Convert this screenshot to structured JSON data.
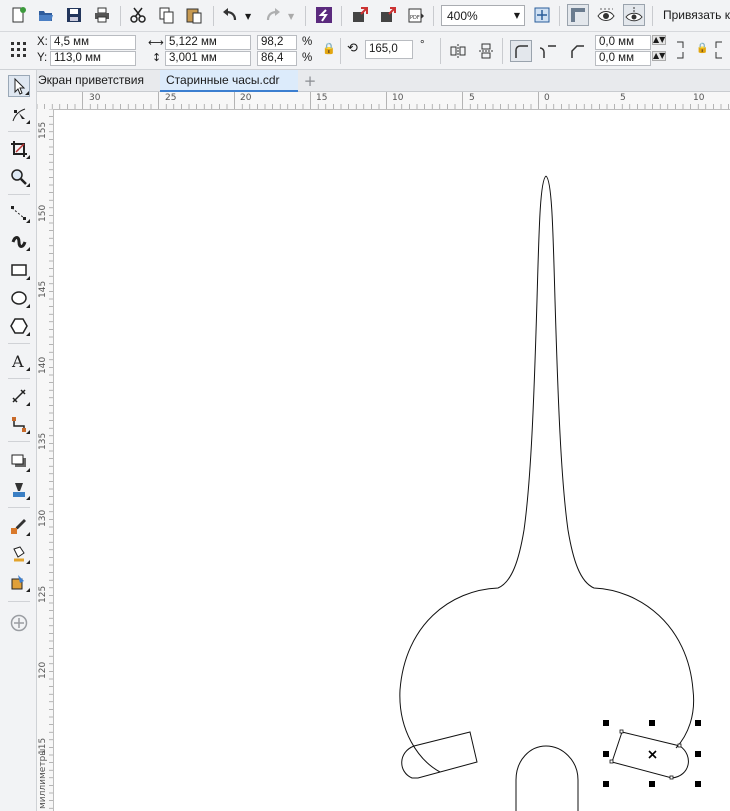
{
  "toolbar": {
    "icons": [
      "new-icon",
      "open-icon",
      "save-icon",
      "print-icon",
      "cut-icon",
      "copy-icon",
      "paste-icon",
      "undo-icon",
      "redo-icon",
      "corel-connect-icon",
      "import-icon",
      "export-icon",
      "export-pdf-icon",
      "zoom-to-page-icon",
      "rulers-toggle-icon",
      "view-icon",
      "snap-guides-icon"
    ],
    "zoom_value": "400%",
    "snap_label": "Привязать к"
  },
  "property_bar": {
    "x_label": "X:",
    "x_value": "4,5 мм",
    "y_label": "Y:",
    "y_value": "113,0 мм",
    "width_value": "5,122 мм",
    "height_value": "3,001 мм",
    "scale_x": "98,2",
    "scale_y": "86,4",
    "percent": "%",
    "rotation_value": "165,0",
    "degree": "°",
    "offset_1": "0,0 мм",
    "offset_2": "0,0 мм"
  },
  "tabs": [
    {
      "label": "Экран приветствия"
    },
    {
      "label": "Старинные часы.cdr"
    }
  ],
  "rulers": {
    "horizontal": [
      "30",
      "25",
      "20",
      "15",
      "10",
      "5",
      "0",
      "5",
      "10"
    ],
    "vertical": [
      "155",
      "150",
      "145",
      "140",
      "135",
      "130",
      "125",
      "120",
      "115"
    ],
    "vertical_unit": "миллиметры"
  },
  "toolbox": [
    "pick-tool-icon",
    "shape-tool-icon",
    "crop-tool-icon",
    "zoom-tool-icon",
    "freehand-tool-icon",
    "artistic-media-icon",
    "rectangle-tool-icon",
    "ellipse-tool-icon",
    "polygon-tool-icon",
    "text-tool-icon",
    "dimension-tool-icon",
    "connector-tool-icon",
    "drop-shadow-tool-icon",
    "transparency-tool-icon",
    "eyedropper-tool-icon",
    "interactive-fill-icon",
    "smart-fill-icon",
    "add-tool-icon"
  ]
}
